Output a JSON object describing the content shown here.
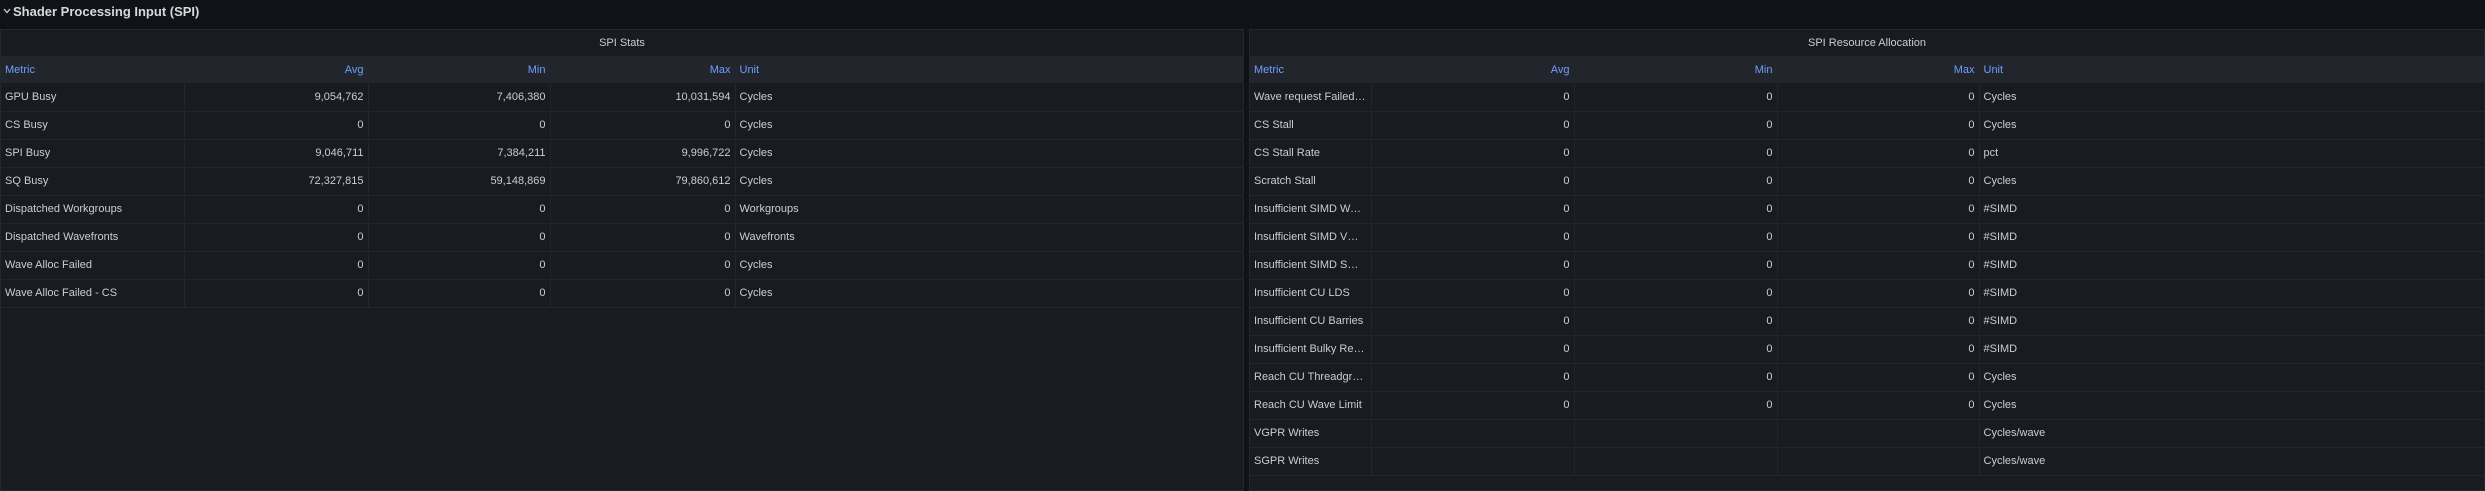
{
  "row": {
    "title": "Shader Processing Input (SPI)"
  },
  "left_panel": {
    "title": "SPI Stats",
    "columns": [
      "Metric",
      "Avg",
      "Min",
      "Max",
      "Unit"
    ],
    "rows": [
      [
        "GPU Busy",
        "9,054,762",
        "7,406,380",
        "10,031,594",
        "Cycles"
      ],
      [
        "CS Busy",
        "0",
        "0",
        "0",
        "Cycles"
      ],
      [
        "SPI Busy",
        "9,046,711",
        "7,384,211",
        "9,996,722",
        "Cycles"
      ],
      [
        "SQ Busy",
        "72,327,815",
        "59,148,869",
        "79,860,612",
        "Cycles"
      ],
      [
        "Dispatched Workgroups",
        "0",
        "0",
        "0",
        "Workgroups"
      ],
      [
        "Dispatched Wavefronts",
        "0",
        "0",
        "0",
        "Wavefronts"
      ],
      [
        "Wave Alloc Failed",
        "0",
        "0",
        "0",
        "Cycles"
      ],
      [
        "Wave Alloc Failed - CS",
        "0",
        "0",
        "0",
        "Cycles"
      ]
    ]
  },
  "right_panel": {
    "title": "SPI Resource Allocation",
    "columns": [
      "Metric",
      "Avg",
      "Min",
      "Max",
      "Unit"
    ],
    "rows": [
      [
        "Wave request Failed (CS)",
        "0",
        "0",
        "0",
        "Cycles"
      ],
      [
        "CS Stall",
        "0",
        "0",
        "0",
        "Cycles"
      ],
      [
        "CS Stall Rate",
        "0",
        "0",
        "0",
        "pct"
      ],
      [
        "Scratch Stall",
        "0",
        "0",
        "0",
        "Cycles"
      ],
      [
        "Insufficient SIMD Waveslots",
        "0",
        "0",
        "0",
        "#SIMD"
      ],
      [
        "Insufficient SIMD VGPRs",
        "0",
        "0",
        "0",
        "#SIMD"
      ],
      [
        "Insufficient SIMD SGPRs",
        "0",
        "0",
        "0",
        "#SIMD"
      ],
      [
        "Insufficient CU LDS",
        "0",
        "0",
        "0",
        "#SIMD"
      ],
      [
        "Insufficient CU Barries",
        "0",
        "0",
        "0",
        "#SIMD"
      ],
      [
        "Insufficient Bulky Resource",
        "0",
        "0",
        "0",
        "#SIMD"
      ],
      [
        "Reach CU Threadgroups Limit",
        "0",
        "0",
        "0",
        "Cycles"
      ],
      [
        "Reach CU Wave Limit",
        "0",
        "0",
        "0",
        "Cycles"
      ],
      [
        "VGPR Writes",
        "",
        "",
        "",
        "Cycles/wave"
      ],
      [
        "SGPR Writes",
        "",
        "",
        "",
        "Cycles/wave"
      ]
    ]
  },
  "colors": {
    "background": "#111217",
    "panel": "#181b1f",
    "header_row": "#22252b",
    "header_text": "#6e9fff",
    "text": "#ccccdc"
  },
  "icons": {
    "row_toggle": "chevron-down-icon"
  }
}
